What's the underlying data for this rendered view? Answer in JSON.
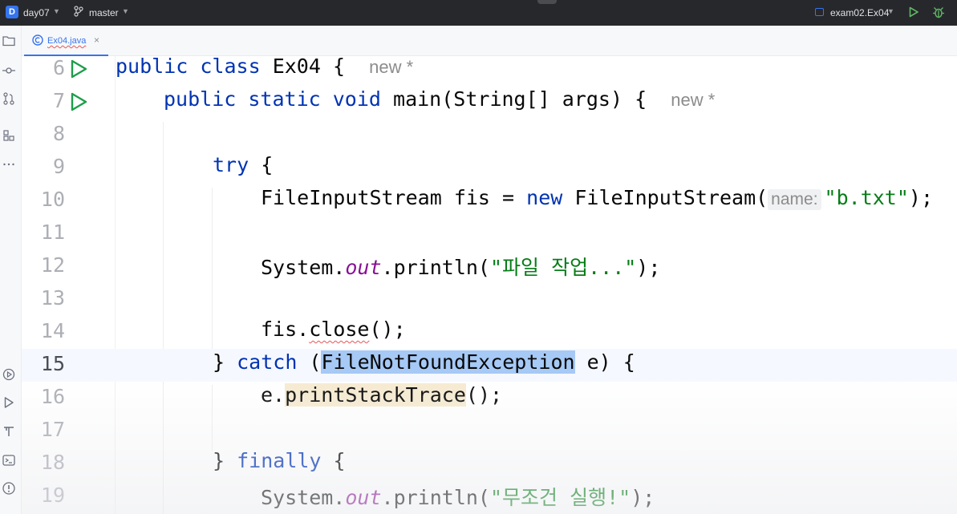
{
  "topbar": {
    "project_badge": "D",
    "project_name": "day07",
    "branch": "master",
    "run_config": "exam02.Ex04",
    "icons": [
      "chevron-down-icon",
      "git-branch-icon",
      "run-icon",
      "debug-icon"
    ],
    "accent_color": "#3574f0"
  },
  "left_toolbar": {
    "icons": [
      "project-folder-icon",
      "commit-icon",
      "pull-requests-icon",
      "structure-icon",
      "more-icon",
      "services-icon",
      "run-icon",
      "terminal-build-icon",
      "terminal-icon",
      "problems-icon"
    ]
  },
  "tabs": [
    {
      "label": "Ex04.java",
      "close": "×",
      "active": true
    }
  ],
  "editor": {
    "caret_line": "15",
    "lines": [
      {
        "num": "6",
        "run": true
      },
      {
        "num": "7",
        "run": true
      },
      {
        "num": "8"
      },
      {
        "num": "9"
      },
      {
        "num": "10"
      },
      {
        "num": "11"
      },
      {
        "num": "12"
      },
      {
        "num": "13"
      },
      {
        "num": "14"
      },
      {
        "num": "15"
      },
      {
        "num": "16"
      },
      {
        "num": "17"
      },
      {
        "num": "18"
      },
      {
        "num": "19"
      }
    ],
    "code": {
      "l6": {
        "kw1": "public",
        "kw2": "class",
        "name": "Ex04",
        "brace": "{",
        "hint": "new *"
      },
      "l7": {
        "kw1": "public",
        "kw2": "static",
        "kw3": "void",
        "sig": "main(String[] args)",
        "brace": "{",
        "hint": "new *"
      },
      "l9": {
        "kw": "try",
        "brace": "{"
      },
      "l10": {
        "decl": "FileInputStream fis = ",
        "kw": "new",
        "ctor": " FileInputStream(",
        "param_hint": "name:",
        "str": "\"b.txt\"",
        "end": ");"
      },
      "l12": {
        "obj": "System.",
        "field": "out",
        "call": ".println(",
        "str": "\"파일 작업...\"",
        "end": ");"
      },
      "l14": {
        "obj": "fis.",
        "method": "close",
        "end": "();"
      },
      "l15": {
        "brace": "} ",
        "kw": "catch",
        "open": " (",
        "type": "FileNotFoundException",
        "rest": " e) {"
      },
      "l16": {
        "obj": "e.",
        "method": "printStackTrace",
        "end": "();"
      },
      "l18": {
        "brace": "} ",
        "kw": "finally",
        "rest": " {"
      },
      "l19": {
        "obj": "System.",
        "field": "out",
        "call": ".println(",
        "str": "\"무조건 실행!\"",
        "end": ");"
      }
    }
  },
  "colors": {
    "keyword": "#0033b3",
    "string": "#067d17",
    "static_field": "#871094",
    "selection": "#a6c9f5",
    "warning_highlight": "#f6ebd1",
    "run_gutter": "#1e9e4a"
  }
}
